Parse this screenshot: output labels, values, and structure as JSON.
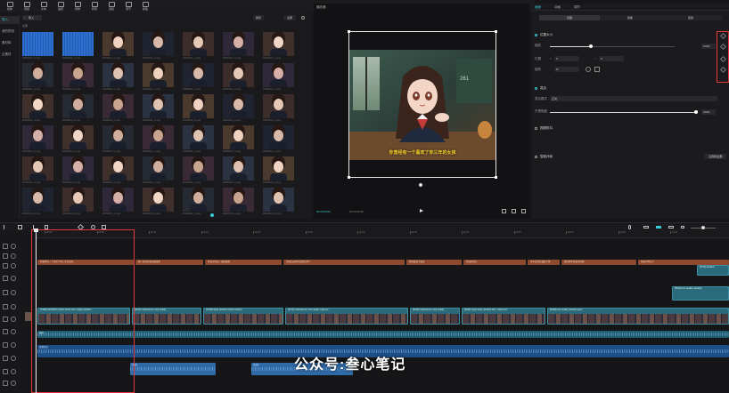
{
  "toolbar": {
    "items": [
      {
        "label": "媒体",
        "icon": "media-icon"
      },
      {
        "label": "音频",
        "icon": "audio-icon"
      },
      {
        "label": "文本",
        "icon": "text-icon"
      },
      {
        "label": "贴纸",
        "icon": "sticker-icon"
      },
      {
        "label": "特效",
        "icon": "effects-icon"
      },
      {
        "label": "转场",
        "icon": "transition-icon"
      },
      {
        "label": "滤镜",
        "icon": "filter-icon"
      },
      {
        "label": "调节",
        "icon": "adjust-icon"
      },
      {
        "label": "模板",
        "icon": "template-icon"
      }
    ]
  },
  "leftnav": {
    "items": [
      "导入",
      "我的预设",
      "素材库",
      "云素材"
    ],
    "active_index": 0
  },
  "media": {
    "import_label": "导入",
    "section_label": "全部",
    "sort_label": "排序",
    "filter_label": "全部",
    "thumb_label": "20230401_xx.png"
  },
  "player": {
    "title": "播放器",
    "subtitle": "你曾经有一个喜欢了你三年的女孩",
    "current_time": "00:00:00:00",
    "total_time": "00:03:46:08",
    "board_text": "261"
  },
  "inspector": {
    "tabs": [
      "画面",
      "动画",
      "调节"
    ],
    "subtabs": [
      "基础",
      "抠像",
      "蒙版"
    ],
    "section_position": "位置大小",
    "scale_label": "缩放",
    "scale_value": "100%",
    "pos_label": "位置",
    "pos_x": "0",
    "pos_y": "0",
    "rotate_label": "旋转",
    "rotate_value": "0°",
    "section_blend": "混合",
    "blend_mode_label": "混合模式",
    "blend_mode_value": "正常",
    "opacity_label": "不透明度",
    "opacity_value": "100%",
    "section_stabilize": "视频防抖",
    "section_smart": "智能补帧",
    "apply_button": "应用到全部",
    "colors": {
      "accent": "#3bc9d6",
      "highlight_box": "#e03a3a"
    }
  },
  "timeline": {
    "ruler_ticks": [
      "00:00",
      "00:05",
      "00:10",
      "00:15",
      "00:20",
      "00:25",
      "00:30",
      "00:35",
      "00:40",
      "00:45",
      "00:50",
      "00:55",
      "01:00"
    ],
    "text_clips": [
      "你曾经有一个喜欢了你三年的女孩",
      "她一直在你身边陪着你",
      "你说过你会一直陪着她",
      "可是后来你们还是分开了",
      "她哭着说了很多",
      "你没有回头",
      "多年后你又遇见了她",
      "她已经不是当年的她",
      "你终于明白了"
    ],
    "video_clips": [
      "[7468] 20230401 perfect anime face, highly detailed",
      "[3104] masterpiece, best quality",
      "[7196] highly detailed school uniform",
      "[4471] masterpiece, best quality, high res",
      "[0166] masterpiece, best quality",
      "[1832] upper body, detailed face, classroom",
      "[0460] best quality, detailed eyes"
    ],
    "small_clips": [
      "[3721] detailed",
      "[5524] best quality, detailed"
    ],
    "audio_labels": [
      "配音",
      "背景音乐",
      "音效1",
      "音效2"
    ],
    "watermark": "公众号:叁心笔记",
    "colors": {
      "text_clip": "#8e4a2e",
      "video_clip": "#2a6a7a",
      "audio": "#2f6aa8",
      "playhead_box": "#e03a3a"
    }
  }
}
